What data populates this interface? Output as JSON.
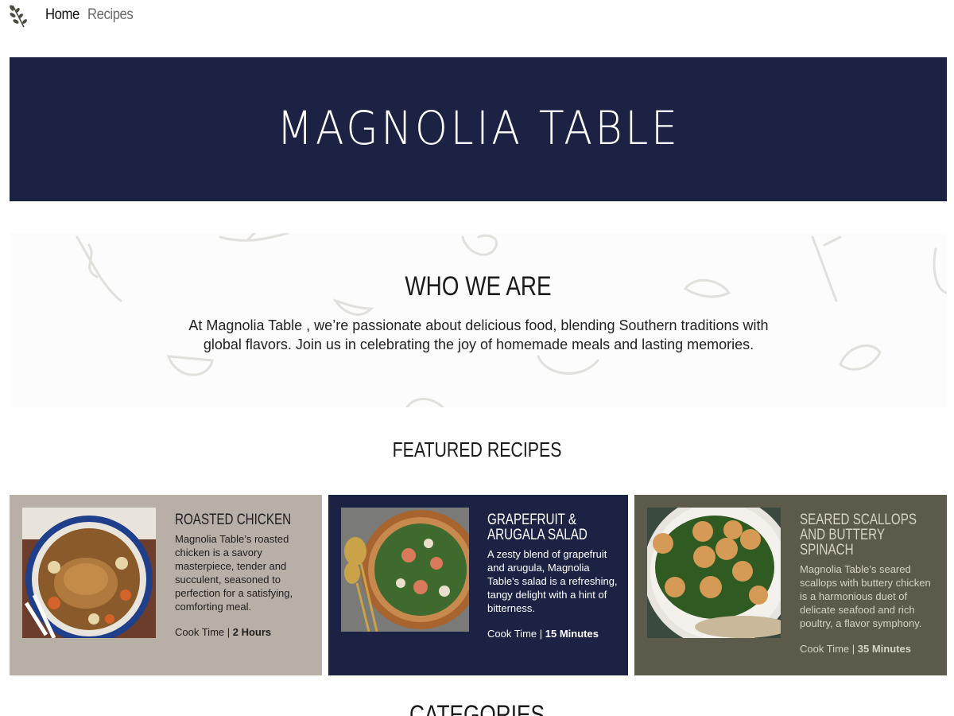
{
  "nav": {
    "logo_icon": "leaf-sprig-icon",
    "home_label": "Home",
    "recipes_label": "Recipes"
  },
  "hero": {
    "title": "MAGNOLIA TABLE",
    "background": "#1b2244"
  },
  "about": {
    "title": "WHO WE ARE",
    "text": "At Magnolia Table , we’re passionate about delicious food, blending Southern traditions with global flavors. Join us in celebrating the joy of homemade meals and lasting memories."
  },
  "featured": {
    "title": "FEATURED RECIPES",
    "cards": [
      {
        "title": "Roasted Chicken",
        "description": "Magnolia Table’s roasted chicken is a savory masterpiece, tender and succulent, seasoned to perfection for a satisfying, comforting meal.",
        "cook_label": "Cook Time |",
        "cook_time": "2 Hours",
        "image_icon": "roasted-chicken-photo",
        "background": "#b8b0a7"
      },
      {
        "title": "Grapefruit & Arugala Salad",
        "description": "A zesty blend of grapefruit and arugula, Magnolia Table's salad is a refreshing, tangy delight with a hint of bitterness.",
        "cook_label": "Cook Time |",
        "cook_time": "15 Minutes",
        "image_icon": "salad-photo",
        "background": "#1b2244"
      },
      {
        "title": "Seared Scallops and Buttery Spinach",
        "description": "Magnolia Table’s seared scallops with buttery chicken is a harmonious duet of delicate seafood and rich poultry, a flavor symphony.",
        "cook_label": "Cook Time |",
        "cook_time": "35 Minutes",
        "image_icon": "scallops-photo",
        "background": "#5c5a4a"
      }
    ]
  },
  "categories": {
    "title": "CATEGORIES"
  }
}
